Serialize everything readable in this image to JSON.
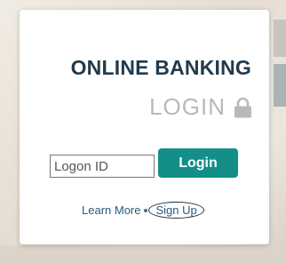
{
  "login_panel": {
    "title": "ONLINE BANKING",
    "subtitle": "LOGIN",
    "lock_icon": "lock-icon",
    "logon_input": {
      "placeholder": "Logon ID",
      "value": ""
    },
    "login_button_label": "Login",
    "learn_more_label": "Learn More",
    "sign_up_label": "Sign Up"
  },
  "colors": {
    "title": "#213a4d",
    "subtitle": "#b9b9b9",
    "login_button": "#138f88",
    "links": "#275b7f"
  }
}
